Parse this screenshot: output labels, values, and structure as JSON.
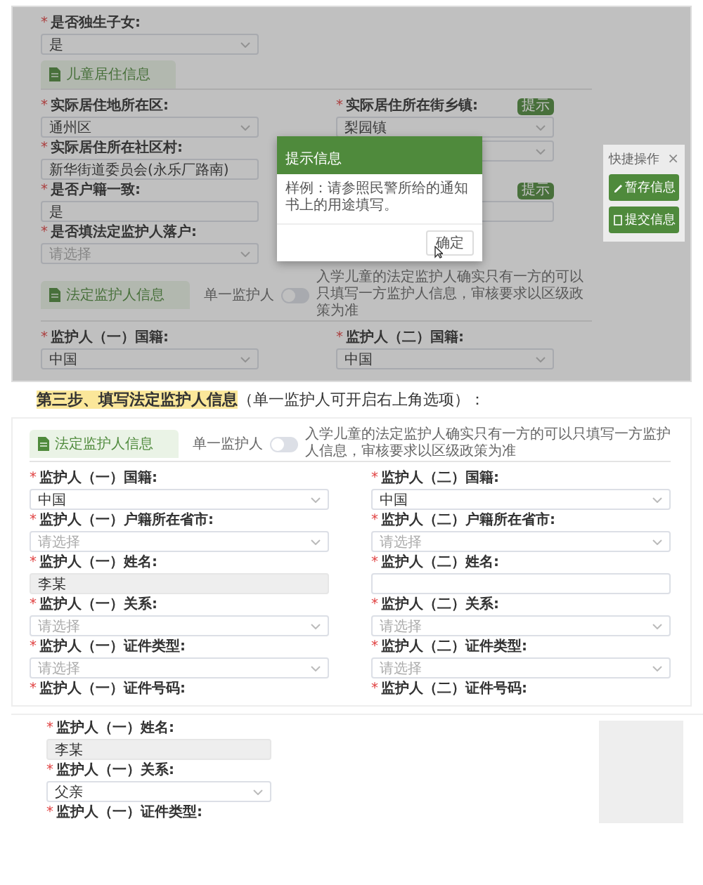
{
  "screenshot_1": {
    "blocks": [
      {
        "kind": "fields",
        "fields": [
          {
            "kind": "select",
            "mark": "*",
            "label": "是否独生子女:",
            "value": "是",
            "disabled": false
          }
        ]
      },
      {
        "kind": "section",
        "title": "儿童居住信息"
      },
      {
        "kind": "fields",
        "fields": [
          {
            "kind": "select",
            "mark": "*",
            "label": "实际居住地所在区:",
            "value": "通州区",
            "disabled": false
          },
          {
            "kind": "select",
            "mark": "*",
            "label": "实际居住所在街乡镇:",
            "value": "梨园镇",
            "badge": "提示",
            "disabled": false
          }
        ]
      },
      {
        "kind": "fields",
        "fields": [
          {
            "kind": "input",
            "mark": "*",
            "label": "实际居住所在社区村:",
            "value": "新华街道委员会(永乐厂路南)",
            "disabled": false
          },
          {
            "kind": "select",
            "disabled": false
          }
        ]
      },
      {
        "kind": "fields",
        "fields": [
          {
            "kind": "input",
            "mark": "*",
            "label": "是否户籍一致:",
            "value": "是",
            "disabled": false
          },
          {
            "kind": "input",
            "badge": "提示",
            "disabled": false
          }
        ]
      },
      {
        "kind": "fields",
        "fields": [
          {
            "kind": "select",
            "mark": "*",
            "label": "是否填法定监护人落户:",
            "placeholder": "请选择",
            "disabled": false
          }
        ]
      },
      {
        "kind": "section",
        "title": "法定监护人信息",
        "toggle_label": "单一监护人",
        "toggle_on": false,
        "notice": "入学儿童的法定监护人确实只有一方的可以只填写一方监护人信息，审核要求以区级政策为准"
      },
      {
        "kind": "fields",
        "fields": [
          {
            "kind": "select",
            "mark": "*",
            "label": "监护人（一）国籍:",
            "value": "中国",
            "disabled": false
          },
          {
            "kind": "select",
            "mark": "*",
            "label": "监护人（二）国籍:",
            "value": "中国",
            "disabled": false
          }
        ]
      }
    ],
    "dialog": {
      "title": "提示信息",
      "message": "样例：请参照民警所给的通知书上的用途填写。",
      "button": "确定"
    },
    "quick_panel": {
      "title": "快捷操作",
      "close": "×",
      "buttons": [
        {
          "kind": "save",
          "label": "暂存信息"
        },
        {
          "kind": "submit",
          "label": "提交信息"
        }
      ]
    }
  },
  "step_heading": {
    "highlight": "第三步、填写法定监护人信息",
    "rest": "（单一监护人可开启右上角选项）："
  },
  "screenshot_2": {
    "blocks": [
      {
        "kind": "section",
        "title": "法定监护人信息",
        "toggle_label": "单一监护人",
        "toggle_on": false,
        "notice": "入学儿童的法定监护人确实只有一方的可以只填写一方监护人信息，审核要求以区级政策为准"
      },
      {
        "kind": "fields",
        "fields": [
          {
            "kind": "select",
            "mark": "*",
            "label": "监护人（一）国籍:",
            "value": "中国",
            "disabled": false
          },
          {
            "kind": "select",
            "mark": "*",
            "label": "监护人（二）国籍:",
            "value": "中国",
            "disabled": false
          }
        ]
      },
      {
        "kind": "fields",
        "fields": [
          {
            "kind": "select",
            "mark": "*",
            "label": "监护人（一）户籍所在省市:",
            "placeholder": "请选择",
            "disabled": false
          },
          {
            "kind": "select",
            "mark": "*",
            "label": "监护人（二）户籍所在省市:",
            "placeholder": "请选择",
            "disabled": false
          }
        ]
      },
      {
        "kind": "fields",
        "fields": [
          {
            "kind": "input",
            "mark": "*",
            "label": "监护人（一）姓名:",
            "value": "李某",
            "disabled": true
          },
          {
            "kind": "input",
            "mark": "*",
            "label": "监护人（二）姓名:",
            "disabled": false
          }
        ]
      },
      {
        "kind": "fields",
        "fields": [
          {
            "kind": "select",
            "mark": "*",
            "label": "监护人（一）关系:",
            "placeholder": "请选择",
            "disabled": false
          },
          {
            "kind": "select",
            "mark": "*",
            "label": "监护人（二）关系:",
            "placeholder": "请选择",
            "disabled": false
          }
        ]
      },
      {
        "kind": "fields",
        "fields": [
          {
            "kind": "select",
            "mark": "*",
            "label": "监护人（一）证件类型:",
            "placeholder": "请选择",
            "disabled": false
          },
          {
            "kind": "select",
            "mark": "*",
            "label": "监护人（二）证件类型:",
            "placeholder": "请选择",
            "disabled": false
          }
        ]
      },
      {
        "kind": "fields",
        "fields": [
          {
            "kind": "label",
            "mark": "*",
            "label": "监护人（一）证件号码:"
          },
          {
            "kind": "label",
            "mark": "*",
            "label": "监护人（二）证件号码:"
          }
        ]
      }
    ]
  },
  "screenshot_3": {
    "blocks": [
      {
        "kind": "fields",
        "fields": [
          {
            "kind": "input",
            "mark": "*",
            "label": "监护人（一）姓名:",
            "value": "李某",
            "disabled": true
          }
        ]
      },
      {
        "kind": "fields",
        "fields": [
          {
            "kind": "select",
            "mark": "*",
            "label": "监护人（一）关系:",
            "value": "父亲",
            "disabled": false
          }
        ]
      },
      {
        "kind": "fields",
        "fields": [
          {
            "kind": "label",
            "mark": "*",
            "label": "监护人（一）证件类型:"
          }
        ]
      }
    ]
  }
}
